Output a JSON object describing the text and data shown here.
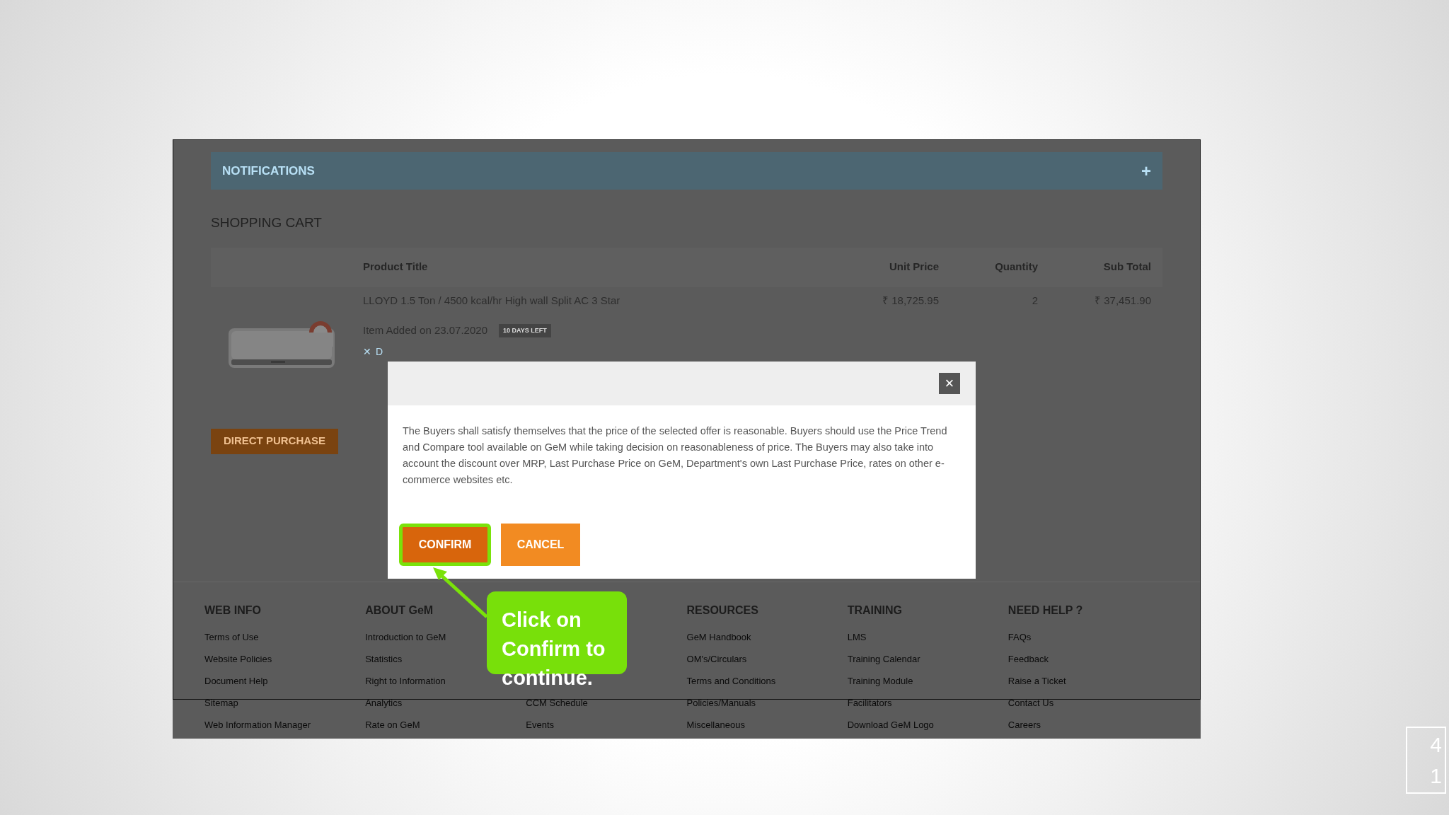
{
  "notifications": {
    "title": "NOTIFICATIONS",
    "expand": "+"
  },
  "cart": {
    "title": "SHOPPING CART",
    "columns": [
      "Product Title",
      "Unit Price",
      "Quantity",
      "Sub Total"
    ],
    "items": [
      {
        "kind": "picture",
        "title": "LLOYD 1.5 Ton / 4500 kcal/hr High wall Split AC 3 Star",
        "unit_price": "₹ 18,725.95",
        "quantity": "2",
        "sub_total": "₹ 37,451.90",
        "added": "Item Added on 23.07.2020",
        "badge": "10 DAYS LEFT",
        "remove_icon": "✕",
        "remove": "D"
      }
    ],
    "action": "DIRECT PURCHASE"
  },
  "footer": [
    {
      "heading": "WEB INFO",
      "links": [
        "Terms of Use",
        "Website Policies",
        "Document Help",
        "Sitemap",
        "Web Information Manager"
      ]
    },
    {
      "heading": "ABOUT GeM",
      "links": [
        "Introduction to GeM",
        "Statistics",
        "Right to Information",
        "Analytics",
        "Rate on GeM"
      ]
    },
    {
      "links": [
        "CCM Schedule",
        "Events"
      ]
    },
    {
      "heading": "RESOURCES",
      "links": [
        "GeM Handbook",
        "OM's/Circulars",
        "Terms and Conditions",
        "Policies/Manuals",
        "Miscellaneous"
      ]
    },
    {
      "heading": "TRAINING",
      "links": [
        "LMS",
        "Training Calendar",
        "Training Module",
        "Facilitators",
        "Download GeM Logo"
      ]
    },
    {
      "heading": "NEED HELP ?",
      "links": [
        "FAQs",
        "Feedback",
        "Raise a Ticket",
        "Contact Us",
        "Careers"
      ]
    }
  ],
  "modal": {
    "close": "×",
    "message": "The Buyers shall satisfy themselves that the price of the selected offer is reasonable. Buyers should use the Price Trend and Compare tool available on GeM while taking decision on reasonableness of price. The Buyers may also take into account the discount over MRP, Last Purchase Price on GeM, Department's own Last Purchase Price, rates on other e-commerce websites etc.",
    "buttons": [
      {
        "label": "CONFIRM",
        "kind": "primary",
        "selected": true
      },
      {
        "label": "CANCEL",
        "kind": "secondary",
        "selected": false
      }
    ]
  },
  "callout": {
    "text": "Click on Confirm to continue."
  },
  "page_number": [
    "4",
    "1"
  ]
}
